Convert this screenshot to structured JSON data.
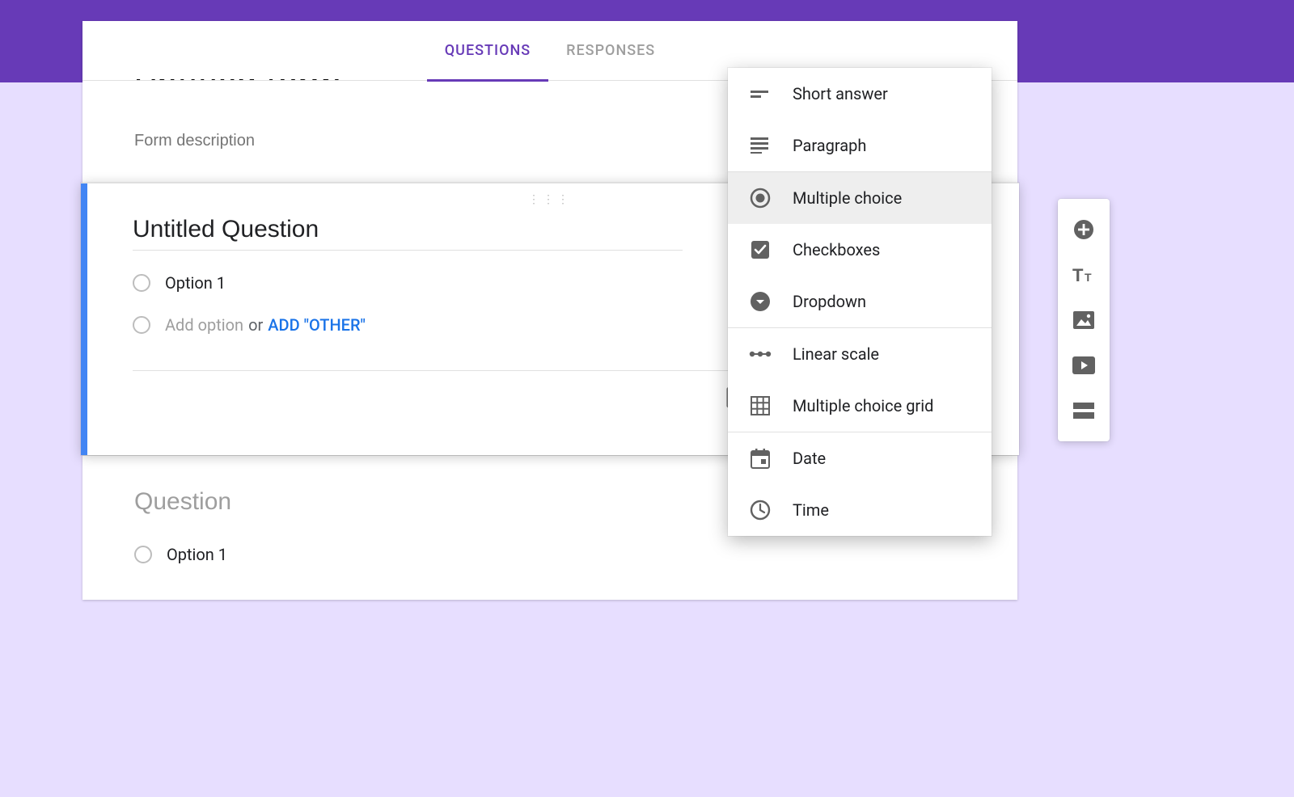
{
  "tabs": {
    "questions": "QUESTIONS",
    "responses": "RESPONSES"
  },
  "form": {
    "title": "Untitled form",
    "description_placeholder": "Form description"
  },
  "active_question": {
    "title": "Untitled Question",
    "options": [
      "Option 1"
    ],
    "add_option": "Add option",
    "or": "or",
    "add_other": "ADD \"OTHER\""
  },
  "second_question": {
    "title": "Question",
    "options": [
      "Option 1"
    ]
  },
  "type_menu": {
    "short_answer": "Short answer",
    "paragraph": "Paragraph",
    "multiple_choice": "Multiple choice",
    "checkboxes": "Checkboxes",
    "dropdown": "Dropdown",
    "linear_scale": "Linear scale",
    "multiple_choice_grid": "Multiple choice grid",
    "date": "Date",
    "time": "Time"
  }
}
